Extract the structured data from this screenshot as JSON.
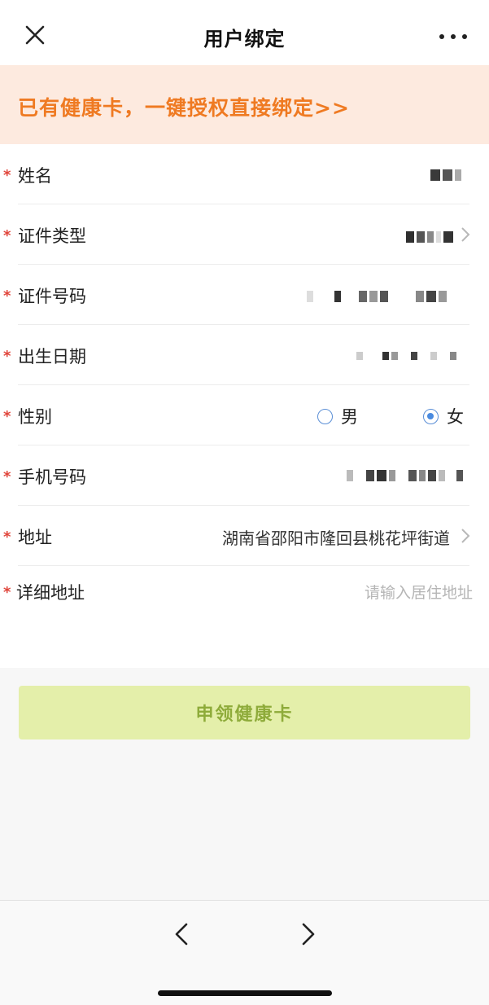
{
  "header": {
    "title": "用户绑定",
    "close_icon": "close-icon",
    "more_icon": "more-horizontal-icon"
  },
  "banner": {
    "text": "已有健康卡，一键授权直接绑定>>",
    "color": "#ef7a22",
    "background": "#fdeadf"
  },
  "form": {
    "required_mark": "*",
    "fields": [
      {
        "label": "姓名",
        "value_visible": false
      },
      {
        "label": "证件类型",
        "value_visible": false
      },
      {
        "label": "证件号码",
        "value_visible": false
      },
      {
        "label": "出生日期",
        "value_visible": false
      },
      {
        "label": "性别"
      },
      {
        "label": "手机号码",
        "value_visible": false
      },
      {
        "label": "地址",
        "value": "湖南省邵阳市隆回县桃花坪街道"
      },
      {
        "label": "详细地址",
        "placeholder": "请输入居住地址"
      }
    ],
    "gender": {
      "options": [
        "男",
        "女"
      ],
      "selected": "女"
    }
  },
  "apply_button": {
    "label": "申领健康卡",
    "background": "#e4efaa",
    "color": "#8eab3a"
  },
  "bottom_nav": {
    "back_icon": "chevron-left-icon",
    "forward_icon": "chevron-right-icon"
  }
}
